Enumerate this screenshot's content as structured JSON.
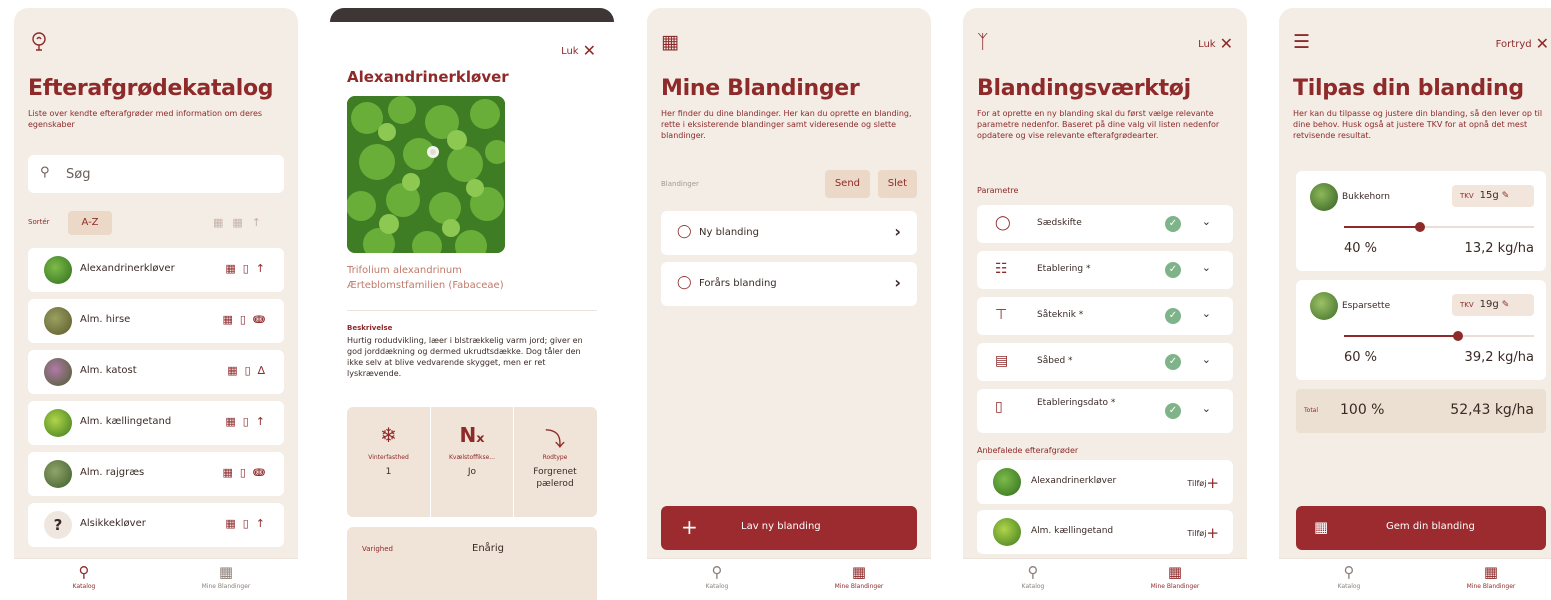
{
  "colors": {
    "accent": "#8e2a2a",
    "background": "#f3ede6",
    "chip": "#ecd8c7",
    "button": "#9b2b2e",
    "check": "#7fb48a"
  },
  "nav": {
    "catalog": "Katalog",
    "mixes": "Mine Blandinger"
  },
  "catalog": {
    "icon": "seedling-bulb-icon",
    "title": "Efterafgrødekatalog",
    "description": "Liste over kendte efterafgrøder med information om deres egenskaber",
    "search_placeholder": "Søg",
    "sort_label": "Sortér",
    "sort_value": "A-Z",
    "plants": [
      {
        "name": "Alexandrinerkløver",
        "thumb": "clover"
      },
      {
        "name": "Alm. hirse",
        "thumb": "millet"
      },
      {
        "name": "Alm. katost",
        "thumb": "mallow"
      },
      {
        "name": "Alm. kællingetand",
        "thumb": "trefoil"
      },
      {
        "name": "Alm. rajgræs",
        "thumb": "grass"
      },
      {
        "name": "Alsikkekløver",
        "thumb": "unknown"
      }
    ]
  },
  "detail": {
    "close": "Luk",
    "title": "Alexandrinerkløver",
    "latin": "Trifolium alexandrinum",
    "family": "Ærteblomstfamilien (Fabaceae)",
    "description_heading": "Beskrivelse",
    "description": "Hurtig rodudvikling, læer i blstrækkelig varm jord; giver en god jorddækning og dermed ukrudtsdække. Dog tåler den ikke selv at blive vedvarende skygget, men er ret lyskrævende.",
    "properties": [
      {
        "label": "Vinterfasthed",
        "value": "1",
        "icon": "snowflake-icon"
      },
      {
        "label": "Kvælstoffikse...",
        "value": "Jo",
        "icon": "nitrogen-icon"
      },
      {
        "label": "Rodtype",
        "value": "Forgrenet pælerod",
        "icon": "root-icon"
      }
    ],
    "duration_label": "Varighed",
    "duration_value": "Enårig"
  },
  "mixes": {
    "title": "Mine Blandinger",
    "description": "Her finder du dine blandinger. Her kan du oprette en blanding, rette i eksisterende blandinger samt videresende og slette blandinger.",
    "list_label": "Blandinger",
    "send": "Send",
    "delete": "Slet",
    "items": [
      {
        "label": "Ny blanding"
      },
      {
        "label": "Forårs blanding"
      }
    ],
    "create_button": "Lav ny blanding"
  },
  "tool": {
    "close": "Luk",
    "title": "Blandingsværktøj",
    "description": "For at oprette en ny blanding skal du først vælge relevante parametre nedenfor. Baseret på dine valg vil listen nedenfor opdatere og vise relevante efterafgrødearter.",
    "params_heading": "Parametre",
    "params": [
      {
        "label": "Sædskifte",
        "icon": "rotation-icon"
      },
      {
        "label": "Etablering *",
        "icon": "establishment-icon"
      },
      {
        "label": "Såteknik *",
        "icon": "sowing-icon"
      },
      {
        "label": "Såbed *",
        "icon": "seedbed-icon"
      },
      {
        "label": "Etableringsdato *",
        "icon": "calendar-icon"
      }
    ],
    "rec_heading": "Anbefalede efterafgrøder",
    "recommended": [
      {
        "name": "Alexandrinerkløver",
        "add": "Tilføj"
      },
      {
        "name": "Alm. kællingetand",
        "add": "Tilføj"
      }
    ]
  },
  "adjust": {
    "continue": "Fortryd",
    "title": "Tilpas din blanding",
    "description": "Her kan du tilpasse og justere din blanding, så den lever op til dine behov. Husk også at justere TKV for at opnå det mest retvisende resultat.",
    "tkv_label": "TKV",
    "items": [
      {
        "name": "Bukkehorn",
        "tkv": "15g",
        "percent": "40 %",
        "kg": "13,2 kg/ha",
        "level": 0.4
      },
      {
        "name": "Esparsette",
        "tkv": "19g",
        "percent": "60 %",
        "kg": "39,2 kg/ha",
        "level": 0.6
      }
    ],
    "total_label": "Total",
    "total_percent": "100 %",
    "total_kg": "52,43 kg/ha",
    "save_button": "Gem din blanding"
  }
}
